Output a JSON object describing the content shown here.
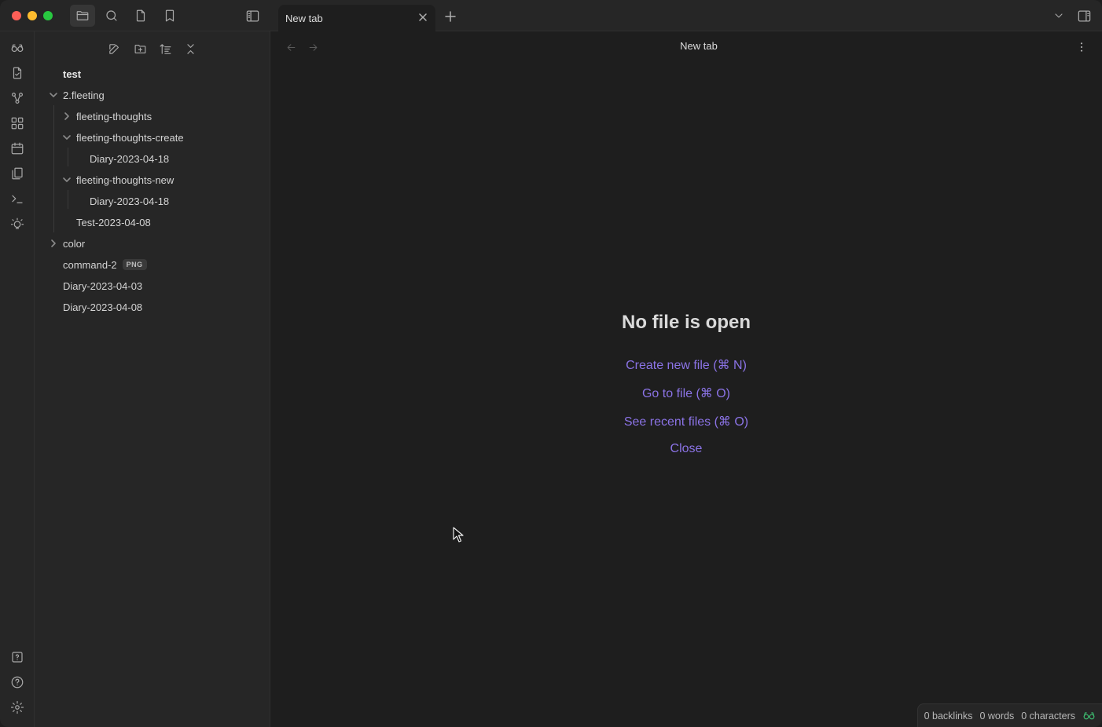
{
  "titlebar": {
    "icons": [
      "folder-icon",
      "search-icon",
      "file-icon",
      "bookmark-icon",
      "sidebar-toggle-icon",
      "chevron-down-icon",
      "right-sidebar-icon"
    ]
  },
  "tab": {
    "label": "New tab"
  },
  "ribbon": {
    "icons": [
      "vault-switch-icon",
      "open-file-icon",
      "graph-view-icon",
      "canvas-icon",
      "daily-note-icon",
      "templates-icon",
      "command-palette-icon",
      "tip-icon",
      "vault-help-icon",
      "help-icon",
      "settings-icon"
    ]
  },
  "file_explorer": {
    "actions": [
      "new-note-icon",
      "new-folder-icon",
      "sort-icon",
      "collapse-all-icon"
    ],
    "vault_name": "test",
    "items": {
      "fleeting": "2.fleeting",
      "fleeting_thoughts": "fleeting-thoughts",
      "fleeting_thoughts_create": "fleeting-thoughts-create",
      "diary_create": "Diary-2023-04-18",
      "fleeting_thoughts_new": "fleeting-thoughts-new",
      "diary_new": "Diary-2023-04-18",
      "test_file": "Test-2023-04-08",
      "color": "color",
      "command2": "command-2",
      "command2_badge": "PNG",
      "diary_0403": "Diary-2023-04-03",
      "diary_0408": "Diary-2023-04-08"
    }
  },
  "main": {
    "title": "New tab",
    "empty_state": {
      "heading": "No file is open",
      "create": "Create new file (⌘ N)",
      "goto": "Go to file (⌘ O)",
      "recent": "See recent files (⌘ O)",
      "close": "Close"
    }
  },
  "status_bar": {
    "backlinks": "0 backlinks",
    "words": "0 words",
    "characters": "0 characters"
  },
  "colors": {
    "accent": "#8b73e6",
    "sync_ok": "#3dbb6f"
  }
}
